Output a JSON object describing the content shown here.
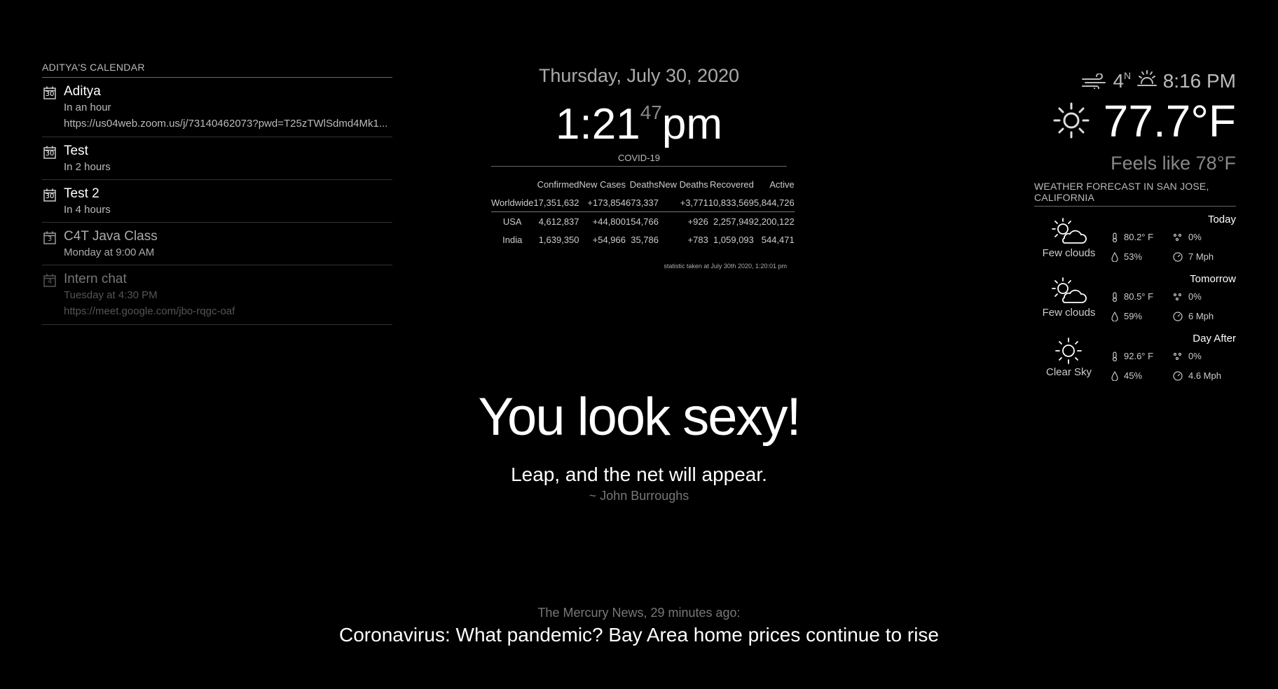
{
  "calendar": {
    "header": "ADITYA'S CALENDAR",
    "events": [
      {
        "day": "30",
        "title": "Aditya",
        "time": "In an hour",
        "url": "https://us04web.zoom.us/j/73140462073?pwd=T25zTWlSdmd4Mk1..."
      },
      {
        "day": "30",
        "title": "Test",
        "time": "In 2 hours",
        "url": ""
      },
      {
        "day": "30",
        "title": "Test 2",
        "time": "In 4 hours",
        "url": ""
      },
      {
        "day": "3",
        "title": "C4T Java Class",
        "time": "Monday at 9:00 AM",
        "url": ""
      },
      {
        "day": "4",
        "title": "Intern chat",
        "time": "Tuesday at 4:30 PM",
        "url": "https://meet.google.com/jbo-rqgc-oaf"
      }
    ]
  },
  "clock": {
    "date": "Thursday, July 30, 2020",
    "time": "1:21",
    "seconds": "47",
    "period": "pm"
  },
  "covid": {
    "header": "COVID-19",
    "columns": [
      "Confirmed",
      "New Cases",
      "Deaths",
      "New Deaths",
      "Recovered",
      "Active"
    ],
    "rows": [
      {
        "country": "Worldwide",
        "confirmed": "17,351,632",
        "new_cases": "+173,854",
        "deaths": "673,337",
        "new_deaths": "+3,771",
        "recovered": "10,833,569",
        "active": "5,844,726"
      },
      {
        "country": "USA",
        "confirmed": "4,612,837",
        "new_cases": "+44,800",
        "deaths": "154,766",
        "new_deaths": "+926",
        "recovered": "2,257,949",
        "active": "2,200,122"
      },
      {
        "country": "India",
        "confirmed": "1,639,350",
        "new_cases": "+54,966",
        "deaths": "35,786",
        "new_deaths": "+783",
        "recovered": "1,059,093",
        "active": "544,471"
      }
    ],
    "timestamp": "statistic taken at July 30th 2020, 1:20:01 pm",
    "colors": {
      "deaths": "#e02020",
      "recovered": "#3cb043",
      "active": "#ffa500"
    }
  },
  "weather_now": {
    "wind_speed": "4",
    "wind_dir": "N",
    "sunset_time": "8:16 PM",
    "temperature": "77.7°F",
    "feels_like": "Feels like 78°F",
    "icons": {
      "wind": "wind-icon",
      "sunset": "sunset-icon",
      "current": "sun-icon"
    }
  },
  "forecast": {
    "header": "WEATHER FORECAST IN SAN JOSE, CALIFORNIA",
    "days": [
      {
        "label": "Today",
        "condition": "Few clouds",
        "icon": "partly-cloudy-icon",
        "temp": "80.2° F",
        "precip": "0%",
        "humidity": "53%",
        "wind": "7 Mph"
      },
      {
        "label": "Tomorrow",
        "condition": "Few clouds",
        "icon": "partly-cloudy-icon",
        "temp": "80.5° F",
        "precip": "0%",
        "humidity": "59%",
        "wind": "6 Mph"
      },
      {
        "label": "Day After",
        "condition": "Clear Sky",
        "icon": "sun-icon",
        "temp": "92.6° F",
        "precip": "0%",
        "humidity": "45%",
        "wind": "4.6 Mph"
      }
    ]
  },
  "compliment": "You look sexy!",
  "quote": {
    "text": "Leap, and the net will appear.",
    "author": "~ John Burroughs"
  },
  "news": {
    "source": "The Mercury News, 29 minutes ago:",
    "headline": "Coronavirus: What pandemic? Bay Area home prices continue to rise"
  }
}
